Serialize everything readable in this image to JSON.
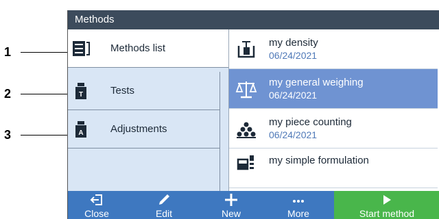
{
  "callouts": [
    "1",
    "2",
    "3"
  ],
  "title": "Methods",
  "nav": [
    {
      "label": "Methods list",
      "icon": "methods-list-icon",
      "active": true
    },
    {
      "label": "Tests",
      "icon": "test-weight-icon"
    },
    {
      "label": "Adjustments",
      "icon": "adjustment-weight-icon"
    }
  ],
  "methods": [
    {
      "name": "my density",
      "date": "06/24/2021",
      "icon": "density-icon"
    },
    {
      "name": "my general weighing",
      "date": "06/24/2021",
      "icon": "scale-icon",
      "selected": true
    },
    {
      "name": "my piece counting",
      "date": "06/24/2021",
      "icon": "piece-counting-icon"
    },
    {
      "name": "my simple formulation",
      "date": "",
      "icon": "formulation-icon"
    }
  ],
  "buttons": [
    {
      "label": "Close",
      "icon": "close-icon"
    },
    {
      "label": "Edit",
      "icon": "edit-icon"
    },
    {
      "label": "New",
      "icon": "add-icon"
    },
    {
      "label": "More",
      "icon": "more-icon"
    },
    {
      "label": "Start method",
      "icon": "play-icon"
    }
  ],
  "colors": {
    "titlebar": "#3c4b5c",
    "nav_bg": "#d9e6f5",
    "selected_row": "#6f93d2",
    "bottombar": "#3e78c0",
    "start_button": "#49b64b"
  }
}
